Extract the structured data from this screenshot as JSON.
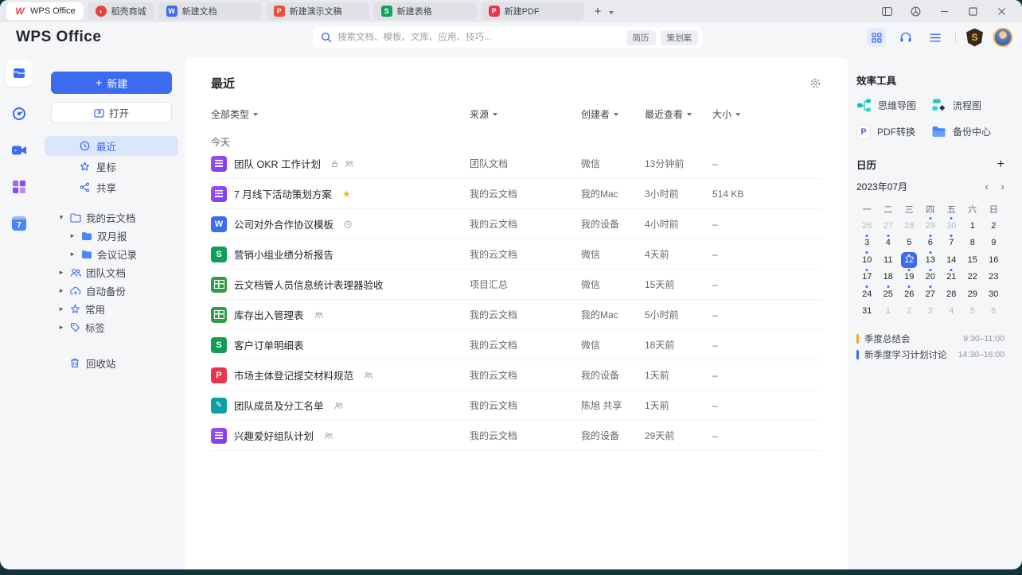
{
  "colors": {
    "accent": "#3c6bf0",
    "event_orange": "#f5a623",
    "event_blue": "#3c6bf0"
  },
  "window": {
    "tabs": [
      {
        "label": "WPS Office",
        "icon": "wps-logo",
        "active": true
      },
      {
        "label": "稻壳商城",
        "icon": "docer",
        "active": false
      },
      {
        "label": "新建文档",
        "icon": "writer-doc",
        "active": false
      },
      {
        "label": "新建演示文稿",
        "icon": "presentation",
        "active": false
      },
      {
        "label": "新建表格",
        "icon": "spreadsheet",
        "active": false
      },
      {
        "label": "新建PDF",
        "icon": "pdf",
        "active": false
      }
    ],
    "new_tab_button": "+"
  },
  "header": {
    "logo": "WPS Office",
    "search": {
      "placeholder": "搜索文档、模板、文库、应用、技巧...",
      "tags": [
        "简历",
        "策划案"
      ]
    },
    "vip_badge": "S"
  },
  "sidebar": {
    "new_button": "新建",
    "open_button": "打开",
    "items": [
      {
        "label": "最近",
        "active": true
      },
      {
        "label": "星标",
        "active": false
      },
      {
        "label": "共享",
        "active": false
      }
    ],
    "tree": [
      {
        "label": "我的云文档",
        "expanded": true,
        "children": [
          {
            "label": "双月报"
          },
          {
            "label": "会议记录"
          }
        ]
      },
      {
        "label": "团队文档"
      },
      {
        "label": "自动备份"
      },
      {
        "label": "常用"
      },
      {
        "label": "标签"
      }
    ],
    "trash_label": "回收站"
  },
  "main": {
    "title": "最近",
    "filters": [
      "全部类型",
      "来源",
      "创建者",
      "最近查看",
      "大小"
    ],
    "group_today": "今天",
    "files": [
      {
        "icon": "docs",
        "title": "团队 OKR 工作计划",
        "badges": [
          "lock",
          "members"
        ],
        "source": "团队文档",
        "creator": "微信",
        "viewed": "13分钟前",
        "size": "–"
      },
      {
        "icon": "docs",
        "title": "7 月线下活动策划方案",
        "badges": [
          "star"
        ],
        "source": "我的云文档",
        "creator": "我的Mac",
        "viewed": "3小时前",
        "size": "514 KB"
      },
      {
        "icon": "word",
        "title": "公司对外合作协议模板",
        "badges": [
          "history"
        ],
        "source": "我的云文档",
        "creator": "我的设备",
        "viewed": "4小时前",
        "size": "–"
      },
      {
        "icon": "sheet",
        "title": "营销小组业绩分析报告",
        "badges": [],
        "source": "我的云文档",
        "creator": "微信",
        "viewed": "4天前",
        "size": "–"
      },
      {
        "icon": "smartsheet",
        "title": "云文档管人员信息统计表理器验收",
        "badges": [],
        "source": "项目汇总",
        "creator": "微信",
        "viewed": "15天前",
        "size": "–"
      },
      {
        "icon": "smartsheet",
        "title": "库存出入管理表",
        "badges": [
          "members"
        ],
        "source": "我的云文档",
        "creator": "我的Mac",
        "viewed": "5小时前",
        "size": "–"
      },
      {
        "icon": "sheet",
        "title": "客户订单明细表",
        "badges": [],
        "source": "我的云文档",
        "creator": "微信",
        "viewed": "18天前",
        "size": "–"
      },
      {
        "icon": "pdf",
        "title": "市场主体登记提交材料规范",
        "badges": [
          "members"
        ],
        "source": "我的云文档",
        "creator": "我的设备",
        "viewed": "1天前",
        "size": "–"
      },
      {
        "icon": "form",
        "title": "团队成员及分工名单",
        "badges": [
          "members"
        ],
        "source": "我的云文档",
        "creator": "陈旭 共享",
        "viewed": "1天前",
        "size": "–"
      },
      {
        "icon": "docs",
        "title": "兴趣爱好组队计划",
        "badges": [
          "members"
        ],
        "source": "我的云文档",
        "creator": "我的设备",
        "viewed": "29天前",
        "size": "–"
      }
    ]
  },
  "right_panel": {
    "tools_title": "效率工具",
    "tools": [
      {
        "label": "思维导图",
        "icon": "mindmap"
      },
      {
        "label": "流程图",
        "icon": "flowchart"
      },
      {
        "label": "PDF转换",
        "icon": "pdf-convert"
      },
      {
        "label": "备份中心",
        "icon": "backup-center"
      }
    ],
    "calendar": {
      "title": "日历",
      "add_button": "+",
      "month": "2023年07月",
      "nav_prev": "‹",
      "nav_next": "›",
      "weekdays": [
        "一",
        "二",
        "三",
        "四",
        "五",
        "六",
        "日"
      ],
      "days": [
        {
          "d": 26,
          "out": true
        },
        {
          "d": 27,
          "out": true
        },
        {
          "d": 28,
          "out": true
        },
        {
          "d": 29,
          "out": true,
          "dot": true
        },
        {
          "d": 30,
          "out": true,
          "dot": true
        },
        {
          "d": 1
        },
        {
          "d": 2
        },
        {
          "d": 3,
          "dot": true
        },
        {
          "d": 4,
          "dot": true
        },
        {
          "d": 5
        },
        {
          "d": 6,
          "dot": true
        },
        {
          "d": 7,
          "dot": true
        },
        {
          "d": 8
        },
        {
          "d": 9
        },
        {
          "d": 10,
          "dot": true
        },
        {
          "d": 11
        },
        {
          "d": 12,
          "sel": true,
          "dot": true
        },
        {
          "d": 13,
          "dot": true
        },
        {
          "d": 14
        },
        {
          "d": 15
        },
        {
          "d": 16
        },
        {
          "d": 17,
          "dot": true
        },
        {
          "d": 18
        },
        {
          "d": 19,
          "dot": true
        },
        {
          "d": 20,
          "dot": true
        },
        {
          "d": 21,
          "dot": true
        },
        {
          "d": 22
        },
        {
          "d": 23
        },
        {
          "d": 24,
          "dot": true
        },
        {
          "d": 25,
          "dot": true
        },
        {
          "d": 26,
          "dot": true
        },
        {
          "d": 27,
          "dot": true
        },
        {
          "d": 28
        },
        {
          "d": 29
        },
        {
          "d": 30
        },
        {
          "d": 31
        },
        {
          "d": 1,
          "out": true
        },
        {
          "d": 2,
          "out": true
        },
        {
          "d": 3,
          "out": true
        },
        {
          "d": 4,
          "out": true
        },
        {
          "d": 5,
          "out": true
        },
        {
          "d": 6,
          "out": true
        }
      ],
      "events": [
        {
          "title": "季度总结会",
          "time": "9:30–11:00",
          "color": "#f5a623"
        },
        {
          "title": "新季度学习计划讨论",
          "time": "14:30–16:00",
          "color": "#3c6bf0"
        }
      ]
    }
  }
}
